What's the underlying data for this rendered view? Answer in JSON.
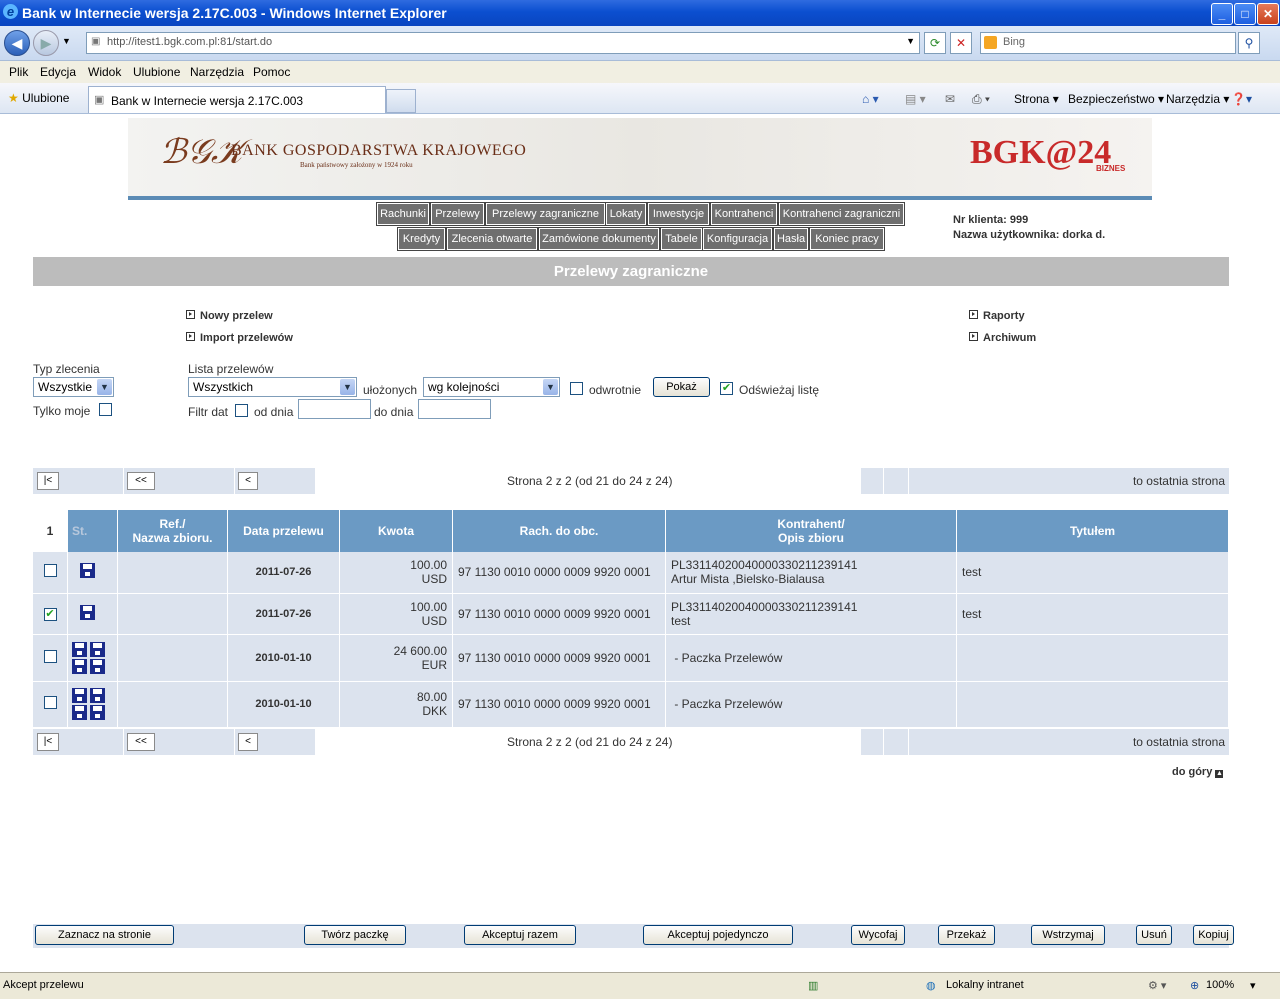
{
  "window": {
    "title": "Bank w Internecie wersja 2.17C.003 - Windows Internet Explorer",
    "controls": {
      "minimize": "_",
      "maximize": "□",
      "close": "✕"
    }
  },
  "address_bar": {
    "url": "http://itest1.bgk.com.pl:81/start.do",
    "search_placeholder": "Bing"
  },
  "menu": [
    "Plik",
    "Edycja",
    "Widok",
    "Ulubione",
    "Narzędzia",
    "Pomoc"
  ],
  "favorites_bar": {
    "favorites_label": "Ulubione",
    "tab_title": "Bank w Internecie wersja 2.17C.003",
    "commands": [
      "Strona ▾",
      "Bezpieczeństwo ▾",
      "Narzędzia ▾"
    ]
  },
  "banner": {
    "bank_name": "BANK GOSPODARSTWA KRAJOWEGO",
    "bank_subtitle": "Bank państwowy założony w 1924 roku",
    "brand": "BGK@24",
    "brand_sub": "BIZNES"
  },
  "nav": {
    "row1": [
      "Rachunki",
      "Przelewy",
      "Przelewy zagraniczne",
      "Lokaty",
      "Inwestycje",
      "Kontrahenci",
      "Kontrahenci zagraniczni"
    ],
    "row2": [
      "Kredyty",
      "Zlecenia otwarte",
      "Zamówione dokumenty",
      "Tabele",
      "Konfiguracja",
      "Hasła",
      "Koniec pracy"
    ]
  },
  "client": {
    "number": "Nr klienta: 999",
    "user": "Nazwa użytkownika: dorka d."
  },
  "section_title": "Przelewy zagraniczne",
  "links": {
    "new_transfer": "Nowy przelew",
    "import": "Import przelewów",
    "reports": "Raporty",
    "archive": "Archiwum"
  },
  "filters": {
    "order_type_label": "Typ zlecenia",
    "order_type_value": "Wszystkie",
    "only_mine_label": "Tylko moje",
    "list_label": "Lista przelewów",
    "list_value": "Wszystkich",
    "sorted_label": "ułożonych",
    "sorted_value": "wg kolejności",
    "reverse_label": "odwrotnie",
    "show_button": "Pokaż",
    "refresh_label": "Odświeżaj listę",
    "date_filter_label": "Filtr dat",
    "from_label": "od dnia",
    "to_label": "do dnia"
  },
  "pager": {
    "first": "|<",
    "prev_page": "<<",
    "prev": "<",
    "info": "Strona 2 z 2 (od 21 do 24 z 24)",
    "last_info": "to ostatnia strona"
  },
  "table": {
    "headers": [
      "1",
      "St.",
      "Ref./\nNazwa zbioru.",
      "Data przelewu",
      "Kwota",
      "Rach. do obc.",
      "Kontrahent/\nOpis zbioru",
      "Tytułem"
    ],
    "rows": [
      {
        "checked": false,
        "disks": 1,
        "date": "2011-07-26",
        "amount": "100.00",
        "currency": "USD",
        "account": "97 1130 0010 0000 0009 9920 0001",
        "contractor1": "PL33114020040000330211239141",
        "contractor2": "Artur Mista ,Bielsko-Bialausa",
        "title": "test"
      },
      {
        "checked": true,
        "disks": 1,
        "date": "2011-07-26",
        "amount": "100.00",
        "currency": "USD",
        "account": "97 1130 0010 0000 0009 9920 0001",
        "contractor1": "PL33114020040000330211239141",
        "contractor2": "test",
        "title": "test"
      },
      {
        "checked": false,
        "disks": 4,
        "date": "2010-01-10",
        "amount": "24 600.00",
        "currency": "EUR",
        "account": "97 1130 0010 0000 0009 9920 0001",
        "contractor1": " - Paczka Przelewów",
        "contractor2": "",
        "title": ""
      },
      {
        "checked": false,
        "disks": 4,
        "date": "2010-01-10",
        "amount": "80.00",
        "currency": "DKK",
        "account": "97 1130 0010 0000 0009 9920 0001",
        "contractor1": " - Paczka Przelewów",
        "contractor2": "",
        "title": ""
      }
    ]
  },
  "to_top": "do góry",
  "actions": [
    "Zaznacz na stronie",
    "Twórz paczkę",
    "Akceptuj razem",
    "Akceptuj pojedynczo",
    "Wycofaj",
    "Przekaż",
    "Wstrzymaj",
    "Usuń",
    "Kopiuj"
  ],
  "status": {
    "text": "Akcept przelewu",
    "zone": "Lokalny intranet",
    "zoom": "100%"
  }
}
